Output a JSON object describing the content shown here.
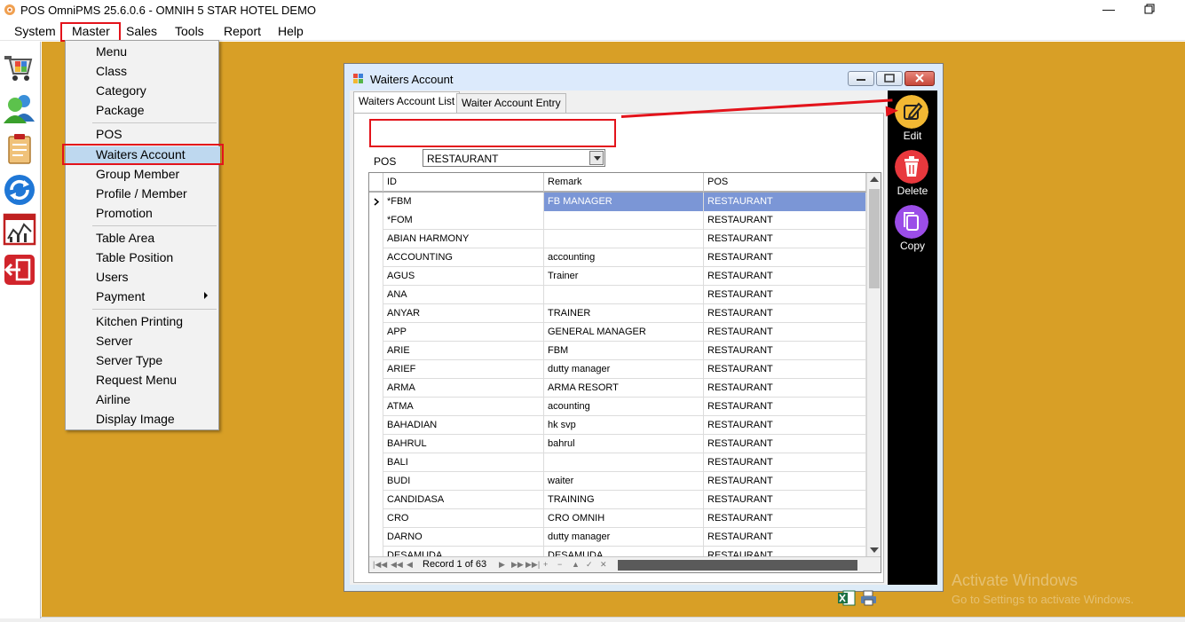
{
  "app": {
    "title": "POS OmniPMS 25.6.0.6 - OMNIH 5 STAR HOTEL DEMO"
  },
  "menubar": {
    "items": [
      "System",
      "Master",
      "Sales",
      "Tools",
      "Report",
      "Help"
    ]
  },
  "master_menu": {
    "items": [
      "Menu",
      "Class",
      "Category",
      "Package",
      "POS",
      "Waiters Account",
      "Group Member",
      "Profile / Member",
      "Promotion",
      "Table Area",
      "Table Position",
      "Users",
      "Payment",
      "Kitchen Printing",
      "Server",
      "Server Type",
      "Request Menu",
      "Airline",
      "Display Image"
    ],
    "highlighted": "Waiters Account"
  },
  "window": {
    "title": "Waiters Account",
    "tabs": [
      "Waiters Account List",
      "Waiter Account Entry"
    ],
    "pos_label": "POS",
    "pos_value": "RESTAURANT"
  },
  "grid": {
    "columns": [
      "ID",
      "Remark",
      "POS"
    ],
    "rows": [
      [
        "*FBM",
        "FB MANAGER",
        "RESTAURANT"
      ],
      [
        "*FOM",
        "",
        "RESTAURANT"
      ],
      [
        "ABIAN HARMONY",
        "",
        "RESTAURANT"
      ],
      [
        "ACCOUNTING",
        "accounting",
        "RESTAURANT"
      ],
      [
        "AGUS",
        "Trainer",
        "RESTAURANT"
      ],
      [
        "ANA",
        "",
        "RESTAURANT"
      ],
      [
        "ANYAR",
        "TRAINER",
        "RESTAURANT"
      ],
      [
        "APP",
        "GENERAL MANAGER",
        "RESTAURANT"
      ],
      [
        "ARIE",
        "FBM",
        "RESTAURANT"
      ],
      [
        "ARIEF",
        "dutty manager",
        "RESTAURANT"
      ],
      [
        "ARMA",
        "ARMA RESORT",
        "RESTAURANT"
      ],
      [
        "ATMA",
        "acounting",
        "RESTAURANT"
      ],
      [
        "BAHADIAN",
        "hk svp",
        "RESTAURANT"
      ],
      [
        "BAHRUL",
        "bahrul",
        "RESTAURANT"
      ],
      [
        "BALI",
        "",
        "RESTAURANT"
      ],
      [
        "BUDI",
        "waiter",
        "RESTAURANT"
      ],
      [
        "CANDIDASA",
        "TRAINING",
        "RESTAURANT"
      ],
      [
        "CRO",
        "CRO OMNIH",
        "RESTAURANT"
      ],
      [
        "DARNO",
        "dutty manager",
        "RESTAURANT"
      ],
      [
        "DESAMUDA",
        "DESAMUDA",
        "RESTAURANT"
      ]
    ],
    "record_text": "Record 1 of 63"
  },
  "actions": {
    "edit": "Edit",
    "delete": "Delete",
    "copy": "Copy"
  },
  "colors": {
    "workspace": "#d89f26",
    "highlight_red": "#e3131b",
    "edit": "#f2b833",
    "delete": "#e8383d",
    "copy": "#9b4de8"
  },
  "watermark": {
    "line1": "Activate Windows",
    "line2": "Go to Settings to activate Windows."
  }
}
